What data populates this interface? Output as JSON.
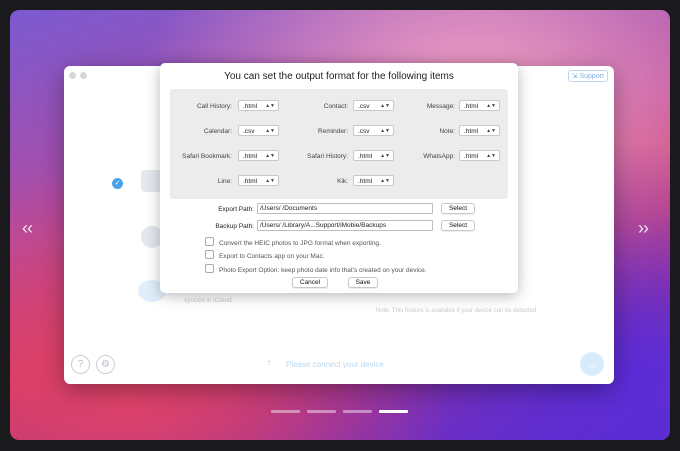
{
  "dialog": {
    "title": "You can set the output format for the following items",
    "formats": [
      {
        "label": "Call History:",
        "value": ".html"
      },
      {
        "label": "Contact:",
        "value": ".csv"
      },
      {
        "label": "Message:",
        "value": ".html"
      },
      {
        "label": "Calendar:",
        "value": ".csv"
      },
      {
        "label": "Reminder:",
        "value": ".csv"
      },
      {
        "label": "Note:",
        "value": ".html"
      },
      {
        "label": "Safari Bookmark:",
        "value": ".html"
      },
      {
        "label": "Safari History:",
        "value": ".html"
      },
      {
        "label": "WhatsApp:",
        "value": ".html"
      },
      {
        "label": "Line:",
        "value": ".html"
      },
      {
        "label": "Kik:",
        "value": ".html"
      }
    ],
    "export_path_label": "Export Path:",
    "export_path_value": "/Users/              /Documents",
    "backup_path_label": "Backup Path:",
    "backup_path_value": "/Users/              /Library/A...Support/iMobie/Backups",
    "select_label": "Select",
    "options": [
      "Convert the HEIC photos to JPG format when exporting.",
      "Export to Contacts app on your Mac.",
      "Photo Export Option: keep photo date info that's created on your device."
    ],
    "cancel_label": "Cancel",
    "save_label": "Save"
  },
  "background_app": {
    "support_label": "Support",
    "synced_text": "synced in iCloud.",
    "note_text": "Note: This feature is available if your device can be detected",
    "connect_text": "Please connect your device",
    "help_icon": "question-icon",
    "settings_icon": "gear-icon"
  },
  "pager": {
    "count": 4,
    "active_index": 3
  }
}
